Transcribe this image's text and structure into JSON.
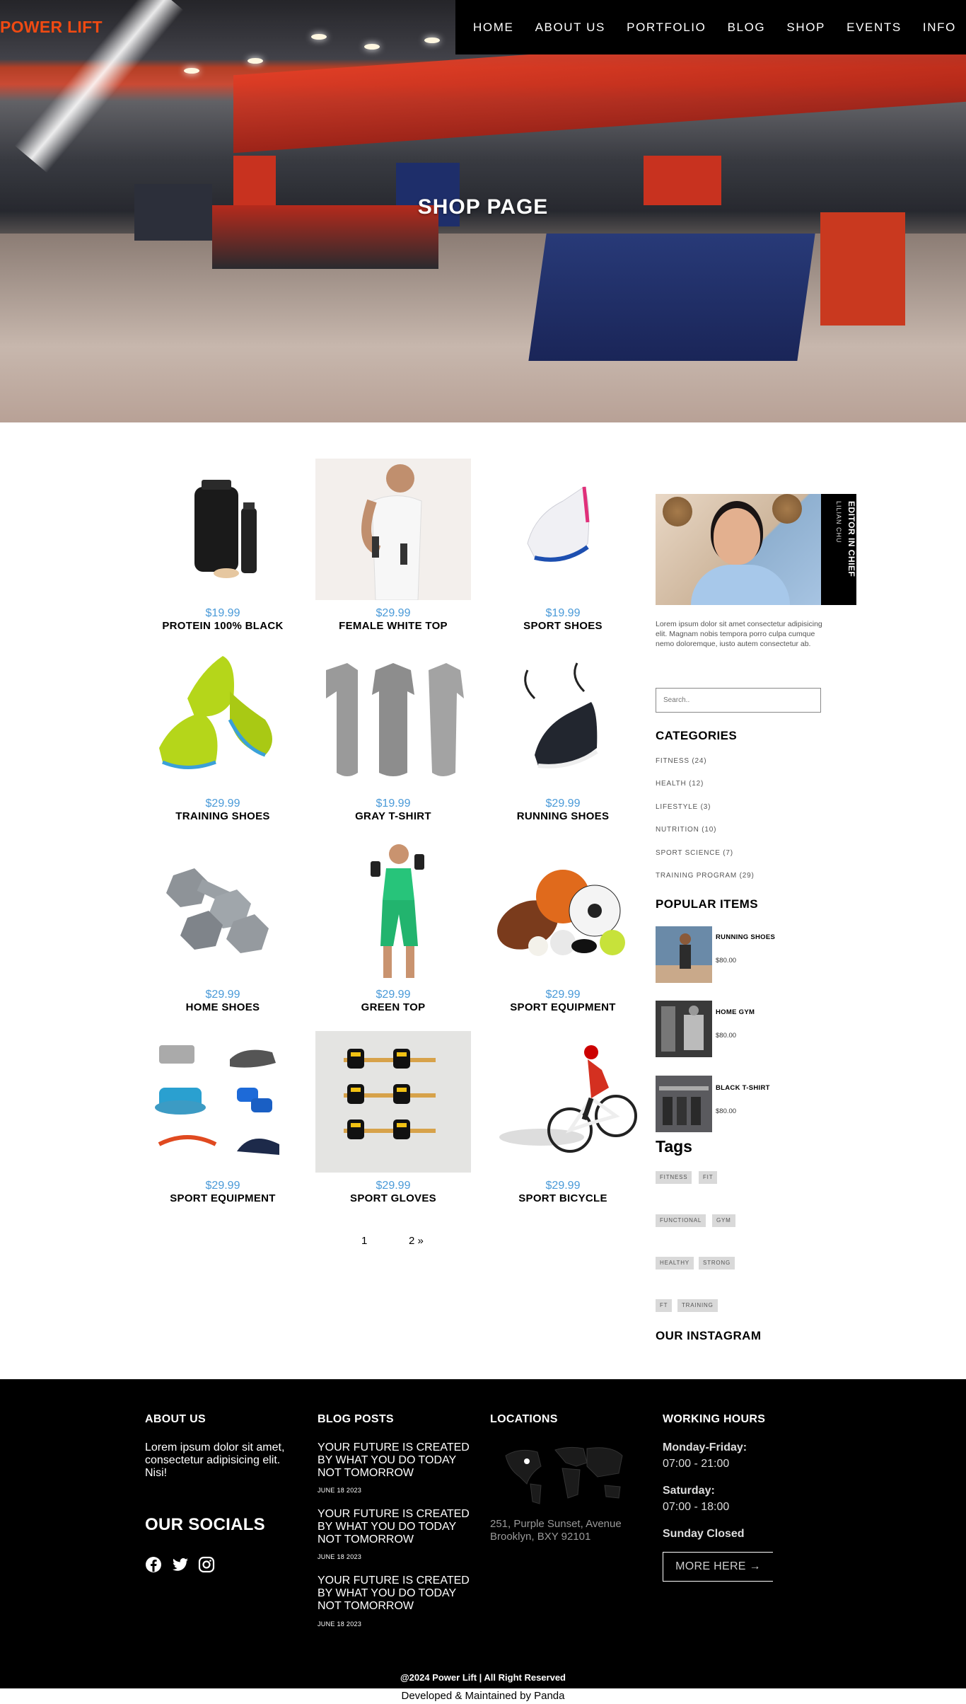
{
  "brand": {
    "logo": "POWER LIFT",
    "accent": "#f04a12"
  },
  "nav": [
    "HOME",
    "ABOUT US",
    "PORTFOLIO",
    "BLOG",
    "SHOP",
    "EVENTS",
    "INFO"
  ],
  "hero": {
    "title": "SHOP PAGE"
  },
  "products": [
    {
      "price": "$19.99",
      "name": "PROTEIN 100% BLACK"
    },
    {
      "price": "$29.99",
      "name": "FEMALE WHITE TOP"
    },
    {
      "price": "$19.99",
      "name": "SPORT SHOES"
    },
    {
      "price": "$29.99",
      "name": "TRAINING SHOES"
    },
    {
      "price": "$19.99",
      "name": "GRAY T-SHIRT"
    },
    {
      "price": "$29.99",
      "name": "RUNNING SHOES"
    },
    {
      "price": "$29.99",
      "name": "HOME SHOES"
    },
    {
      "price": "$29.99",
      "name": "GREEN TOP"
    },
    {
      "price": "$29.99",
      "name": "SPORT EQUIPMENT"
    },
    {
      "price": "$29.99",
      "name": "SPORT EQUIPMENT"
    },
    {
      "price": "$29.99",
      "name": "SPORT GLOVES"
    },
    {
      "price": "$29.99",
      "name": "SPORT BICYCLE"
    }
  ],
  "pagination": {
    "page1": "1",
    "next": "2 »"
  },
  "sidebar": {
    "editor_title": "EDITOR IN CHIEF",
    "editor_name": "LILIAN CHU",
    "lorem": "Lorem ipsum dolor sit amet consectetur adipisicing elit. Magnam nobis tempora porro culpa cumque nemo doloremque, iusto autem consectetur ab.",
    "search_placeholder": "Search..",
    "categories_title": "CATEGORIES",
    "categories": [
      "FITNESS (24)",
      "HEALTH (12)",
      "LIFESTYLE (3)",
      "NUTRITION (10)",
      "SPORT SCIENCE (7)",
      "TRAINING PROGRAM (29)"
    ],
    "popular_title": "POPULAR ITEMS",
    "popular": [
      {
        "name": "RUNNING SHOES",
        "price": "$80.00"
      },
      {
        "name": "HOME GYM",
        "price": "$80.00"
      },
      {
        "name": "BLACK T-SHIRT",
        "price": "$80.00"
      }
    ],
    "tags_title": "Tags",
    "tags": [
      "FITNESS",
      "FIT",
      "FUNCTIONAL",
      "GYM",
      "HEALTHY",
      "STRONG",
      "FT",
      "TRAINING"
    ],
    "instagram_title": "OUR INSTAGRAM"
  },
  "footer": {
    "about_title": "ABOUT US",
    "about_text": "Lorem ipsum dolor sit amet, consectetur adipisicing elit. Nisi!",
    "socials_title": "OUR SOCIALS",
    "blog_title": "BLOG POSTS",
    "posts": [
      {
        "title": "YOUR FUTURE IS CREATED BY WHAT YOU DO TODAY NOT TOMORROW",
        "date": "JUNE 18 2023"
      },
      {
        "title": "YOUR FUTURE IS CREATED BY WHAT YOU DO TODAY NOT TOMORROW",
        "date": "JUNE 18 2023"
      },
      {
        "title": "YOUR FUTURE IS CREATED BY WHAT YOU DO TODAY NOT TOMORROW",
        "date": "JUNE 18 2023"
      }
    ],
    "locations_title": "LOCATIONS",
    "address_line1": "251, Purple Sunset, Avenue",
    "address_line2": "Brooklyn, BXY 92101",
    "hours_title": "WORKING HOURS",
    "weekday_label": "Monday-Friday:",
    "weekday_hours": "07:00 - 21:00",
    "saturday_label": "Saturday:",
    "saturday_hours": "07:00 - 18:00",
    "sunday": "Sunday Closed",
    "more_button": "MORE HERE →"
  },
  "copyright": "@2024 Power Lift | All Right Reserved",
  "credit": "Developed & Maintained by Panda"
}
